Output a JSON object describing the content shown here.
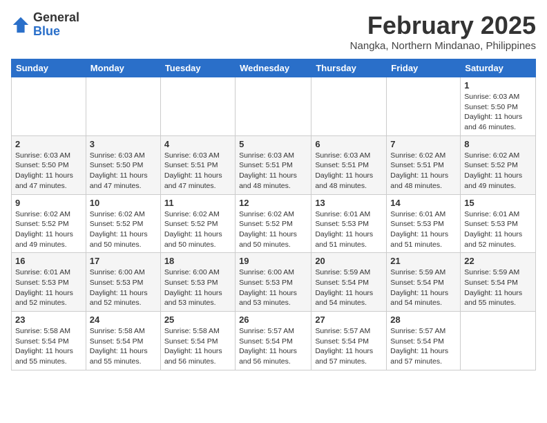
{
  "logo": {
    "general": "General",
    "blue": "Blue"
  },
  "title": {
    "month_year": "February 2025",
    "location": "Nangka, Northern Mindanao, Philippines"
  },
  "days_of_week": [
    "Sunday",
    "Monday",
    "Tuesday",
    "Wednesday",
    "Thursday",
    "Friday",
    "Saturday"
  ],
  "weeks": [
    [
      {
        "day": "",
        "info": ""
      },
      {
        "day": "",
        "info": ""
      },
      {
        "day": "",
        "info": ""
      },
      {
        "day": "",
        "info": ""
      },
      {
        "day": "",
        "info": ""
      },
      {
        "day": "",
        "info": ""
      },
      {
        "day": "1",
        "info": "Sunrise: 6:03 AM\nSunset: 5:50 PM\nDaylight: 11 hours and 46 minutes."
      }
    ],
    [
      {
        "day": "2",
        "info": "Sunrise: 6:03 AM\nSunset: 5:50 PM\nDaylight: 11 hours and 47 minutes."
      },
      {
        "day": "3",
        "info": "Sunrise: 6:03 AM\nSunset: 5:50 PM\nDaylight: 11 hours and 47 minutes."
      },
      {
        "day": "4",
        "info": "Sunrise: 6:03 AM\nSunset: 5:51 PM\nDaylight: 11 hours and 47 minutes."
      },
      {
        "day": "5",
        "info": "Sunrise: 6:03 AM\nSunset: 5:51 PM\nDaylight: 11 hours and 48 minutes."
      },
      {
        "day": "6",
        "info": "Sunrise: 6:03 AM\nSunset: 5:51 PM\nDaylight: 11 hours and 48 minutes."
      },
      {
        "day": "7",
        "info": "Sunrise: 6:02 AM\nSunset: 5:51 PM\nDaylight: 11 hours and 48 minutes."
      },
      {
        "day": "8",
        "info": "Sunrise: 6:02 AM\nSunset: 5:52 PM\nDaylight: 11 hours and 49 minutes."
      }
    ],
    [
      {
        "day": "9",
        "info": "Sunrise: 6:02 AM\nSunset: 5:52 PM\nDaylight: 11 hours and 49 minutes."
      },
      {
        "day": "10",
        "info": "Sunrise: 6:02 AM\nSunset: 5:52 PM\nDaylight: 11 hours and 50 minutes."
      },
      {
        "day": "11",
        "info": "Sunrise: 6:02 AM\nSunset: 5:52 PM\nDaylight: 11 hours and 50 minutes."
      },
      {
        "day": "12",
        "info": "Sunrise: 6:02 AM\nSunset: 5:52 PM\nDaylight: 11 hours and 50 minutes."
      },
      {
        "day": "13",
        "info": "Sunrise: 6:01 AM\nSunset: 5:53 PM\nDaylight: 11 hours and 51 minutes."
      },
      {
        "day": "14",
        "info": "Sunrise: 6:01 AM\nSunset: 5:53 PM\nDaylight: 11 hours and 51 minutes."
      },
      {
        "day": "15",
        "info": "Sunrise: 6:01 AM\nSunset: 5:53 PM\nDaylight: 11 hours and 52 minutes."
      }
    ],
    [
      {
        "day": "16",
        "info": "Sunrise: 6:01 AM\nSunset: 5:53 PM\nDaylight: 11 hours and 52 minutes."
      },
      {
        "day": "17",
        "info": "Sunrise: 6:00 AM\nSunset: 5:53 PM\nDaylight: 11 hours and 52 minutes."
      },
      {
        "day": "18",
        "info": "Sunrise: 6:00 AM\nSunset: 5:53 PM\nDaylight: 11 hours and 53 minutes."
      },
      {
        "day": "19",
        "info": "Sunrise: 6:00 AM\nSunset: 5:53 PM\nDaylight: 11 hours and 53 minutes."
      },
      {
        "day": "20",
        "info": "Sunrise: 5:59 AM\nSunset: 5:54 PM\nDaylight: 11 hours and 54 minutes."
      },
      {
        "day": "21",
        "info": "Sunrise: 5:59 AM\nSunset: 5:54 PM\nDaylight: 11 hours and 54 minutes."
      },
      {
        "day": "22",
        "info": "Sunrise: 5:59 AM\nSunset: 5:54 PM\nDaylight: 11 hours and 55 minutes."
      }
    ],
    [
      {
        "day": "23",
        "info": "Sunrise: 5:58 AM\nSunset: 5:54 PM\nDaylight: 11 hours and 55 minutes."
      },
      {
        "day": "24",
        "info": "Sunrise: 5:58 AM\nSunset: 5:54 PM\nDaylight: 11 hours and 55 minutes."
      },
      {
        "day": "25",
        "info": "Sunrise: 5:58 AM\nSunset: 5:54 PM\nDaylight: 11 hours and 56 minutes."
      },
      {
        "day": "26",
        "info": "Sunrise: 5:57 AM\nSunset: 5:54 PM\nDaylight: 11 hours and 56 minutes."
      },
      {
        "day": "27",
        "info": "Sunrise: 5:57 AM\nSunset: 5:54 PM\nDaylight: 11 hours and 57 minutes."
      },
      {
        "day": "28",
        "info": "Sunrise: 5:57 AM\nSunset: 5:54 PM\nDaylight: 11 hours and 57 minutes."
      },
      {
        "day": "",
        "info": ""
      }
    ]
  ]
}
